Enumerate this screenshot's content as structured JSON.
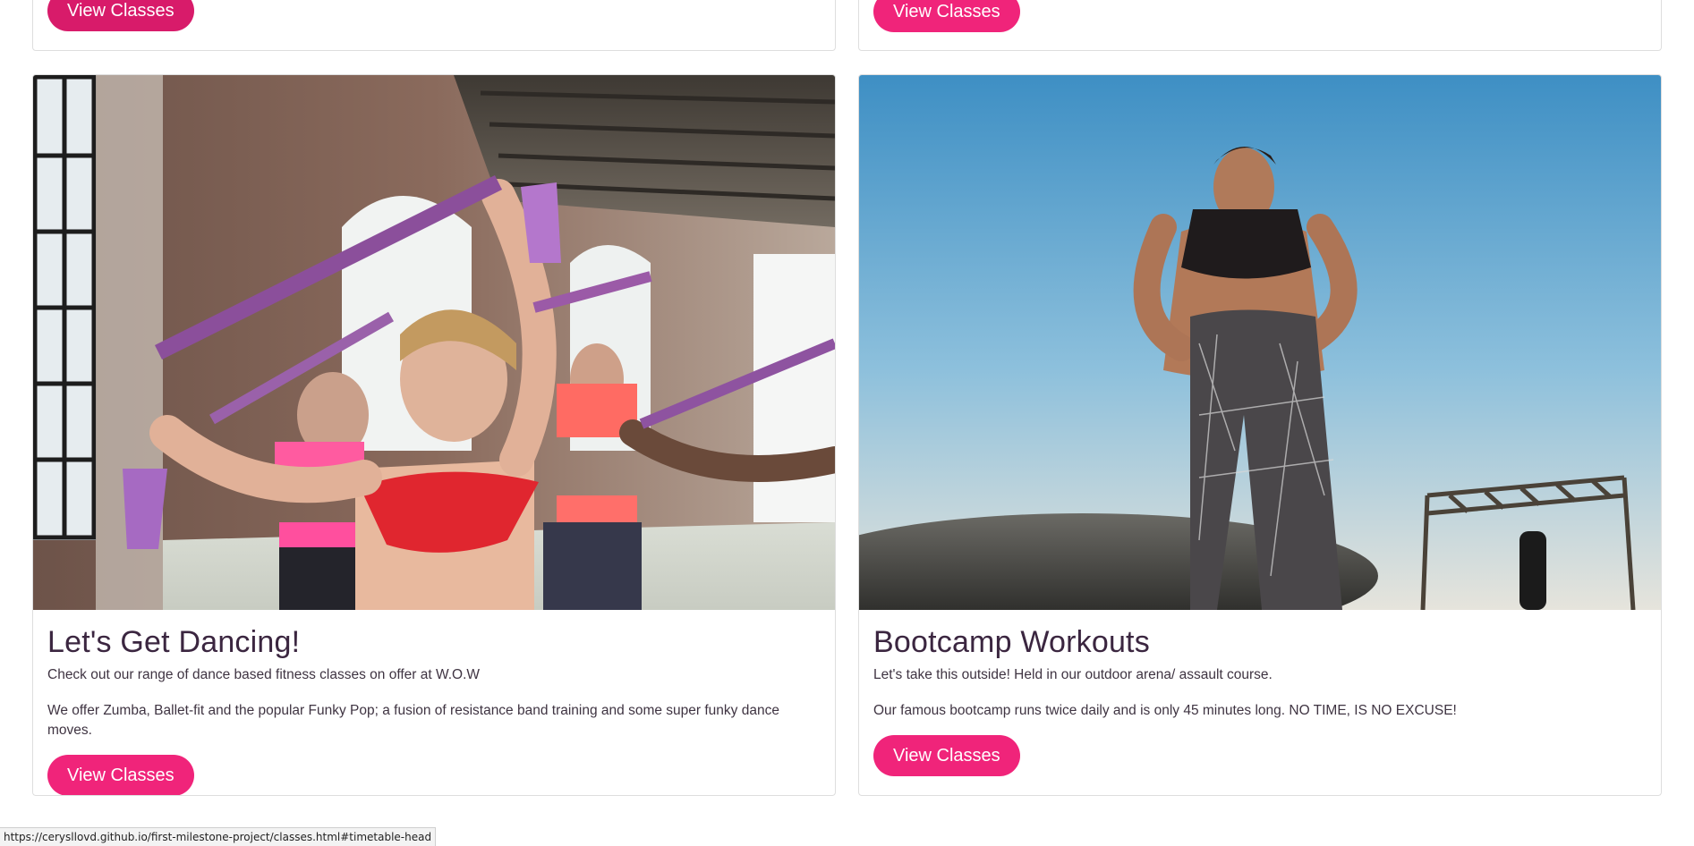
{
  "cards": [
    {
      "button_label": "View Classes"
    },
    {
      "button_label": "View Classes"
    },
    {
      "title": "Let's Get Dancing!",
      "text1": "Check out our range of dance based fitness classes on offer at W.O.W",
      "text2": "We offer Zumba, Ballet-fit and the popular Funky Pop; a fusion of resistance band training and some super funky dance moves.",
      "button_label": "View Classes"
    },
    {
      "title": "Bootcamp Workouts",
      "text1": "Let's take this outside! Held in our outdoor arena/ assault course.",
      "text2": "Our famous bootcamp runs twice daily and is only 45 minutes long. NO TIME, IS NO EXCUSE!",
      "button_label": "View Classes"
    }
  ],
  "status_bar": {
    "url": "https://cerysllovd.github.io/first-milestone-project/classes.html#timetable-head"
  },
  "colors": {
    "accent": "#f0247a",
    "accent_dark": "#d81b6a",
    "border": "#dedede"
  }
}
